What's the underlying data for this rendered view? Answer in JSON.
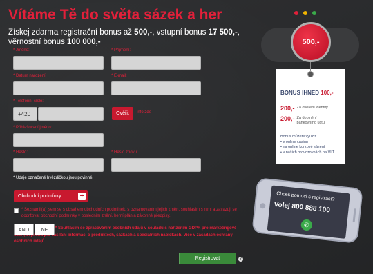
{
  "header": {
    "title": "Vítáme Tě do světa sázek a her",
    "subtitle_parts": [
      {
        "text": "Získej zdarma registrační bonus až ",
        "bold": false
      },
      {
        "text": "500,-",
        "bold": true
      },
      {
        "text": ", vstupní bonus ",
        "bold": false
      },
      {
        "text": "17 500,-",
        "bold": true
      },
      {
        "text": ", věrnostní bonus ",
        "bold": false
      },
      {
        "text": "100 000,-",
        "bold": true
      }
    ],
    "dot_colors": [
      "#e2203a",
      "#f0b400",
      "#3aaa4a"
    ]
  },
  "form": {
    "first_name_label": "* Jméno:",
    "last_name_label": "* Příjmení:",
    "birth_date_label": "* Datum narození:",
    "email_label": "* E-mail:",
    "phone_label": "* Telefonní číslo:",
    "phone_prefix": "+420",
    "verify_label": "Ověřit",
    "info_link": "info zde",
    "username_label": "* Přihlašovací jméno:",
    "password_label": "* Heslo:",
    "password_repeat_label": "* Heslo znovu:",
    "required_note": "* Údaje označené hvězdičkou jsou povinné."
  },
  "terms": {
    "rules_button": "Obchodní podmínky",
    "consent_text": "* Seznámil(a) jsem se s obsahem obchodních podmínek, s oznamováním jejich změn, souhlasím s nimi a zavazuji se dodržovat obchodní podmínky v posledním znění, herní plán a zákonné předpisy.",
    "yes_label": "ANO",
    "no_label": "NE",
    "gdpr_text": "* Souhlasím se zpracováním osobních údajů v souladu s nařízením GDPR pro marketingové účely, zejména pro zasílání informací o produktech, sázkách a speciálních nabídkách. Více v zásadách ochrany osobních údajů.",
    "register_button": "Registrovat",
    "help_icon": "?"
  },
  "promo": {
    "coin_amount": "500,-",
    "tag_title": "BONUS IHNED",
    "tag_title_amount": "100,-",
    "rows": [
      {
        "amount": "200,-",
        "desc": "Za ověření identity"
      },
      {
        "amount": "200,-",
        "desc": "Za doplnění bankovního účtu"
      }
    ],
    "usage_title": "Bonus můžete využít:",
    "usage_items": [
      "v online casinu",
      "na online kurzové sázení",
      "v našich provozovnách na VLT"
    ]
  },
  "phone": {
    "question": "Chceš pomoci s registrací?",
    "number": "Volej  800 888 100"
  }
}
